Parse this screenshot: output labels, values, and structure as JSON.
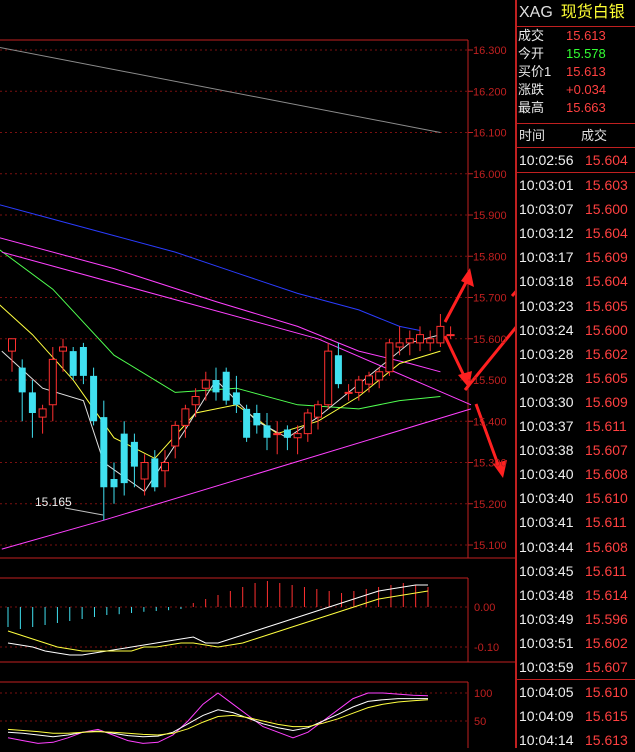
{
  "quote": {
    "symbol": "XAG",
    "name": "现货白银",
    "rows": [
      {
        "label": "成交",
        "value": "15.613",
        "color": "#ff4040"
      },
      {
        "label": "今开",
        "value": "15.578",
        "color": "#33ff33"
      },
      {
        "label": "买价1",
        "value": "15.613",
        "color": "#ff4040"
      },
      {
        "label": "涨跌",
        "value": "+0.034",
        "color": "#ff4040"
      },
      {
        "label": "最高",
        "value": "15.663",
        "color": "#ff4040"
      }
    ]
  },
  "trades": {
    "header_time": "时间",
    "header_price": "成交",
    "rows": [
      {
        "time": "10:02:56",
        "price": "15.604"
      },
      {
        "time": "10:03:01",
        "price": "15.603"
      },
      {
        "time": "10:03:07",
        "price": "15.600"
      },
      {
        "time": "10:03:12",
        "price": "15.604"
      },
      {
        "time": "10:03:17",
        "price": "15.609"
      },
      {
        "time": "10:03:18",
        "price": "15.604"
      },
      {
        "time": "10:03:23",
        "price": "15.605"
      },
      {
        "time": "10:03:24",
        "price": "15.600"
      },
      {
        "time": "10:03:28",
        "price": "15.602"
      },
      {
        "time": "10:03:28",
        "price": "15.605"
      },
      {
        "time": "10:03:30",
        "price": "15.609"
      },
      {
        "time": "10:03:37",
        "price": "15.611"
      },
      {
        "time": "10:03:38",
        "price": "15.607"
      },
      {
        "time": "10:03:40",
        "price": "15.608"
      },
      {
        "time": "10:03:40",
        "price": "15.610"
      },
      {
        "time": "10:03:41",
        "price": "15.611"
      },
      {
        "time": "10:03:44",
        "price": "15.608"
      },
      {
        "time": "10:03:45",
        "price": "15.611"
      },
      {
        "time": "10:03:48",
        "price": "15.614"
      },
      {
        "time": "10:03:49",
        "price": "15.596"
      },
      {
        "time": "10:03:51",
        "price": "15.602"
      },
      {
        "time": "10:03:59",
        "price": "15.607"
      },
      {
        "time": "10:04:05",
        "price": "15.610"
      },
      {
        "time": "10:04:09",
        "price": "15.615"
      },
      {
        "time": "10:04:14",
        "price": "15.613"
      }
    ]
  },
  "chart_data": [
    {
      "type": "candlestick",
      "panel": "price",
      "y_ticks": [
        "16.300",
        "16.200",
        "16.100",
        "16.000",
        "15.900",
        "15.800",
        "15.700",
        "15.600",
        "15.500",
        "15.400",
        "15.300",
        "15.200",
        "15.100"
      ],
      "ylim": [
        15.08,
        16.33
      ],
      "low_annotation": "15.165",
      "candles": [
        {
          "o": 15.57,
          "h": 15.6,
          "l": 15.52,
          "c": 15.6
        },
        {
          "o": 15.53,
          "h": 15.55,
          "l": 15.4,
          "c": 15.47
        },
        {
          "o": 15.47,
          "h": 15.5,
          "l": 15.36,
          "c": 15.42
        },
        {
          "o": 15.41,
          "h": 15.44,
          "l": 15.37,
          "c": 15.43
        },
        {
          "o": 15.44,
          "h": 15.58,
          "l": 15.4,
          "c": 15.55
        },
        {
          "o": 15.57,
          "h": 15.6,
          "l": 15.52,
          "c": 15.58
        },
        {
          "o": 15.57,
          "h": 15.58,
          "l": 15.5,
          "c": 15.51
        },
        {
          "o": 15.58,
          "h": 15.59,
          "l": 15.49,
          "c": 15.51
        },
        {
          "o": 15.51,
          "h": 15.53,
          "l": 15.39,
          "c": 15.4
        },
        {
          "o": 15.41,
          "h": 15.45,
          "l": 15.16,
          "c": 15.24
        },
        {
          "o": 15.26,
          "h": 15.3,
          "l": 15.2,
          "c": 15.24
        },
        {
          "o": 15.37,
          "h": 15.4,
          "l": 15.22,
          "c": 15.25
        },
        {
          "o": 15.35,
          "h": 15.37,
          "l": 15.24,
          "c": 15.29
        },
        {
          "o": 15.26,
          "h": 15.32,
          "l": 15.22,
          "c": 15.3
        },
        {
          "o": 15.31,
          "h": 15.33,
          "l": 15.23,
          "c": 15.24
        },
        {
          "o": 15.28,
          "h": 15.33,
          "l": 15.24,
          "c": 15.3
        },
        {
          "o": 15.34,
          "h": 15.4,
          "l": 15.31,
          "c": 15.39
        },
        {
          "o": 15.39,
          "h": 15.44,
          "l": 15.36,
          "c": 15.43
        },
        {
          "o": 15.44,
          "h": 15.48,
          "l": 15.41,
          "c": 15.46
        },
        {
          "o": 15.48,
          "h": 15.52,
          "l": 15.45,
          "c": 15.5
        },
        {
          "o": 15.5,
          "h": 15.53,
          "l": 15.45,
          "c": 15.47
        },
        {
          "o": 15.52,
          "h": 15.53,
          "l": 15.44,
          "c": 15.45
        },
        {
          "o": 15.47,
          "h": 15.51,
          "l": 15.42,
          "c": 15.44
        },
        {
          "o": 15.43,
          "h": 15.44,
          "l": 15.35,
          "c": 15.36
        },
        {
          "o": 15.42,
          "h": 15.44,
          "l": 15.37,
          "c": 15.39
        },
        {
          "o": 15.39,
          "h": 15.42,
          "l": 15.33,
          "c": 15.36
        },
        {
          "o": 15.37,
          "h": 15.4,
          "l": 15.32,
          "c": 15.37
        },
        {
          "o": 15.38,
          "h": 15.39,
          "l": 15.33,
          "c": 15.36
        },
        {
          "o": 15.36,
          "h": 15.39,
          "l": 15.32,
          "c": 15.37
        },
        {
          "o": 15.37,
          "h": 15.43,
          "l": 15.35,
          "c": 15.42
        },
        {
          "o": 15.41,
          "h": 15.45,
          "l": 15.38,
          "c": 15.44
        },
        {
          "o": 15.44,
          "h": 15.59,
          "l": 15.43,
          "c": 15.57
        },
        {
          "o": 15.56,
          "h": 15.59,
          "l": 15.48,
          "c": 15.49
        },
        {
          "o": 15.47,
          "h": 15.49,
          "l": 15.45,
          "c": 15.47
        },
        {
          "o": 15.47,
          "h": 15.51,
          "l": 15.45,
          "c": 15.5
        },
        {
          "o": 15.49,
          "h": 15.52,
          "l": 15.47,
          "c": 15.51
        },
        {
          "o": 15.5,
          "h": 15.53,
          "l": 15.48,
          "c": 15.52
        },
        {
          "o": 15.52,
          "h": 15.6,
          "l": 15.51,
          "c": 15.59
        },
        {
          "o": 15.58,
          "h": 15.63,
          "l": 15.56,
          "c": 15.59
        },
        {
          "o": 15.59,
          "h": 15.62,
          "l": 15.56,
          "c": 15.6
        },
        {
          "o": 15.59,
          "h": 15.63,
          "l": 15.57,
          "c": 15.61
        },
        {
          "o": 15.59,
          "h": 15.62,
          "l": 15.57,
          "c": 15.6
        },
        {
          "o": 15.59,
          "h": 15.66,
          "l": 15.58,
          "c": 15.63
        },
        {
          "o": 15.61,
          "h": 15.63,
          "l": 15.6,
          "c": 15.61
        }
      ],
      "lines": [
        {
          "name": "MA-gray",
          "color": "#8c8c8c",
          "points": [
            [
              -2,
              16.31
            ],
            [
              42,
              16.1
            ]
          ]
        },
        {
          "name": "MA-blue",
          "color": "#2a3cff",
          "points": [
            [
              -2,
              15.93
            ],
            [
              4,
              15.89
            ],
            [
              10,
              15.85
            ],
            [
              16,
              15.81
            ],
            [
              22,
              15.76
            ],
            [
              28,
              15.71
            ],
            [
              34,
              15.67
            ],
            [
              38,
              15.63
            ],
            [
              40,
              15.62
            ]
          ]
        },
        {
          "name": "MA-magenta",
          "color": "#ff40ff",
          "points": [
            [
              -2,
              15.85
            ],
            [
              10,
              15.77
            ],
            [
              20,
              15.69
            ],
            [
              28,
              15.63
            ],
            [
              34,
              15.57
            ],
            [
              39,
              15.54
            ],
            [
              42,
              15.52
            ]
          ]
        },
        {
          "name": "MA-green",
          "color": "#50ff50",
          "points": [
            [
              -2,
              15.83
            ],
            [
              4,
              15.72
            ],
            [
              10,
              15.56
            ],
            [
              16,
              15.47
            ],
            [
              22,
              15.48
            ],
            [
              28,
              15.44
            ],
            [
              34,
              15.43
            ],
            [
              38,
              15.45
            ],
            [
              42,
              15.46
            ]
          ]
        },
        {
          "name": "MA-yellow",
          "color": "#ffff40",
          "points": [
            [
              -2,
              15.7
            ],
            [
              2,
              15.61
            ],
            [
              6,
              15.5
            ],
            [
              10,
              15.36
            ],
            [
              14,
              15.31
            ],
            [
              18,
              15.42
            ],
            [
              22,
              15.44
            ],
            [
              26,
              15.37
            ],
            [
              30,
              15.4
            ],
            [
              34,
              15.46
            ],
            [
              38,
              15.54
            ],
            [
              42,
              15.57
            ]
          ]
        },
        {
          "name": "MA-white",
          "color": "#e0e0e0",
          "points": [
            [
              -1,
              15.57
            ],
            [
              3,
              15.48
            ],
            [
              7,
              15.45
            ],
            [
              9,
              15.3
            ],
            [
              13,
              15.23
            ],
            [
              17,
              15.38
            ],
            [
              20,
              15.5
            ],
            [
              24,
              15.4
            ],
            [
              27,
              15.36
            ],
            [
              30,
              15.41
            ],
            [
              33,
              15.47
            ],
            [
              36,
              15.53
            ],
            [
              39,
              15.59
            ],
            [
              42,
              15.61
            ]
          ]
        },
        {
          "name": "Trend-up",
          "color": "#ff40ff",
          "points": [
            [
              -1,
              15.09
            ],
            [
              9,
              15.16
            ],
            [
              45,
              15.43
            ]
          ]
        },
        {
          "name": "Trend-down",
          "color": "#ff40ff",
          "points": [
            [
              -1,
              15.81
            ],
            [
              30,
              15.6
            ],
            [
              45,
              15.44
            ]
          ]
        }
      ]
    },
    {
      "type": "bar",
      "panel": "macd",
      "y_ticks": [
        "0.00",
        "-0.10"
      ],
      "ylim": [
        -0.14,
        0.11
      ],
      "values": [
        -0.05,
        -0.055,
        -0.05,
        -0.045,
        -0.04,
        -0.035,
        -0.03,
        -0.025,
        -0.02,
        -0.018,
        -0.015,
        -0.012,
        -0.01,
        -0.008,
        -0.005,
        0.01,
        0.02,
        0.03,
        0.04,
        0.05,
        0.06,
        0.065,
        0.06,
        0.055,
        0.05,
        0.045,
        0.04,
        0.035,
        0.04,
        0.045,
        0.05,
        0.055,
        0.06,
        0.055,
        0.05
      ],
      "lines": [
        {
          "name": "DIF",
          "color": "#ffffff",
          "values": [
            -0.09,
            -0.095,
            -0.1,
            -0.11,
            -0.115,
            -0.12,
            -0.12,
            -0.115,
            -0.11,
            -0.105,
            -0.1,
            -0.095,
            -0.09,
            -0.085,
            -0.08,
            -0.075,
            -0.09,
            -0.09,
            -0.08,
            -0.07,
            -0.06,
            -0.05,
            -0.04,
            -0.03,
            -0.02,
            -0.01,
            0.0,
            0.01,
            0.02,
            0.03,
            0.04,
            0.045,
            0.05,
            0.055,
            0.055
          ]
        },
        {
          "name": "DEA",
          "color": "#ffff40",
          "values": [
            -0.06,
            -0.07,
            -0.08,
            -0.09,
            -0.1,
            -0.105,
            -0.11,
            -0.11,
            -0.11,
            -0.11,
            -0.11,
            -0.1,
            -0.1,
            -0.095,
            -0.09,
            -0.09,
            -0.095,
            -0.1,
            -0.095,
            -0.09,
            -0.08,
            -0.07,
            -0.06,
            -0.05,
            -0.04,
            -0.03,
            -0.02,
            -0.01,
            0.0,
            0.01,
            0.02,
            0.025,
            0.03,
            0.035,
            0.04
          ]
        }
      ]
    },
    {
      "type": "line",
      "panel": "kdj",
      "y_ticks": [
        "100",
        "50"
      ],
      "ylim": [
        0,
        110
      ],
      "lines": [
        {
          "name": "J",
          "color": "#ff40ff",
          "values": [
            20,
            15,
            10,
            12,
            20,
            30,
            35,
            25,
            15,
            10,
            12,
            25,
            50,
            80,
            100,
            80,
            60,
            40,
            30,
            20,
            30,
            50,
            70,
            90,
            100,
            100,
            98,
            96,
            95
          ]
        },
        {
          "name": "K",
          "color": "#ffffff",
          "values": [
            30,
            28,
            25,
            22,
            25,
            30,
            32,
            28,
            24,
            22,
            23,
            30,
            45,
            60,
            70,
            65,
            55,
            45,
            38,
            33,
            38,
            50,
            62,
            75,
            85,
            88,
            90,
            90,
            90
          ]
        },
        {
          "name": "D",
          "color": "#ffff40",
          "values": [
            35,
            33,
            31,
            28,
            28,
            30,
            31,
            30,
            28,
            26,
            25,
            28,
            36,
            48,
            58,
            60,
            56,
            50,
            44,
            40,
            40,
            46,
            54,
            64,
            74,
            80,
            84,
            86,
            88
          ]
        }
      ]
    }
  ]
}
